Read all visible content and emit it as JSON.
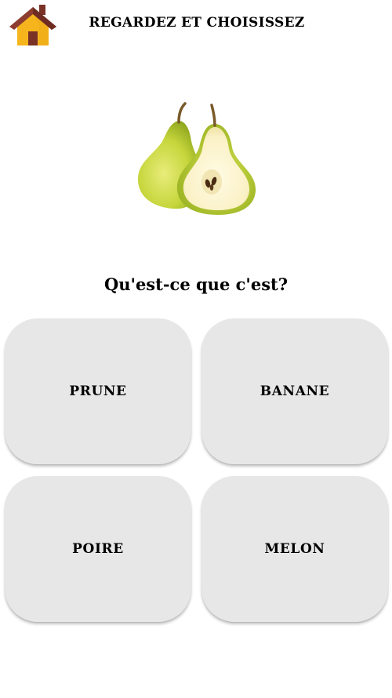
{
  "header": {
    "title": "REGARDEZ ET CHOISISSEZ",
    "home_icon": "house-icon"
  },
  "prompt": {
    "image_icon": "pear-icon",
    "question": "Qu'est-ce que c'est?"
  },
  "answers": [
    {
      "label": "PRUNE"
    },
    {
      "label": "BANANE"
    },
    {
      "label": "POIRE"
    },
    {
      "label": "MELON"
    }
  ],
  "colors": {
    "background": "#ffffff",
    "button_fill": "#e7e7e7",
    "text": "#000000",
    "house_roof": "#8a3b2e",
    "house_wall": "#f5b419",
    "pear_green": "#bcd13d"
  }
}
